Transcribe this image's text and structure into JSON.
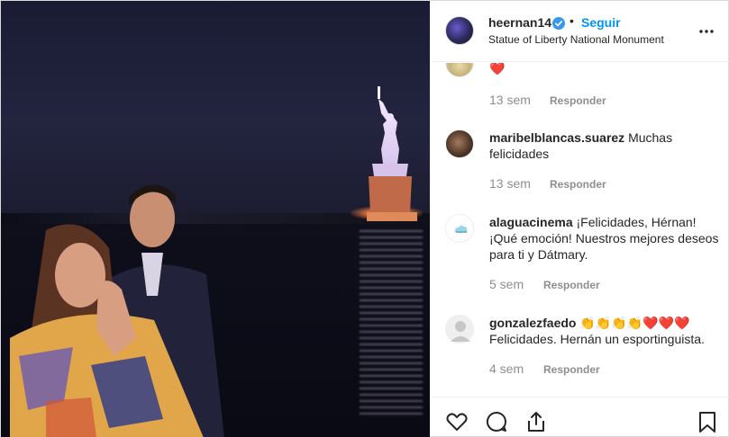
{
  "header": {
    "username": "heernan14",
    "follow_label": "Seguir",
    "separator": "•",
    "location": "Statue of Liberty National Monument"
  },
  "comments": [
    {
      "username": "",
      "text": "❤️",
      "time": "13 sem",
      "reply_label": "Responder"
    },
    {
      "username": "maribelblancas.suarez",
      "text": " Muchas felicidades",
      "time": "13 sem",
      "reply_label": "Responder"
    },
    {
      "username": "alaguacinema",
      "text": " ¡Felicidades, Hérnan! ¡Qué emoción! Nuestros mejores deseos para ti y Dátmary.",
      "time": "5 sem",
      "reply_label": "Responder"
    },
    {
      "username": "gonzalezfaedo",
      "text": " 👏👏👏👏❤️❤️❤️ Felicidades. Hernán un esportinguista.",
      "time": "4 sem",
      "reply_label": "Responder"
    }
  ],
  "icons": {
    "like": "heart-icon",
    "comment": "comment-icon",
    "share": "share-icon",
    "save": "bookmark-icon",
    "more": "more-options-icon",
    "verified": "verified-badge-icon"
  },
  "colors": {
    "link_blue": "#0095f6",
    "verified_blue": "#3897f0",
    "text": "#262626",
    "muted": "#8e8e8e",
    "heart_red": "#ed4956"
  }
}
